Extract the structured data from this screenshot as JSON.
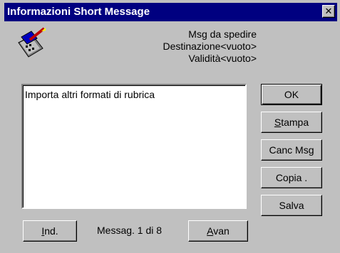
{
  "window": {
    "title": "Informazioni Short Message",
    "close": "✕"
  },
  "info": {
    "line1": "Msg da spedire",
    "line2": "Destinazione<vuoto>",
    "line3": "Validità<vuoto>"
  },
  "message": {
    "text": "Importa altri formati di rubrica"
  },
  "buttons": {
    "ok": "OK",
    "stampa_u": "S",
    "stampa_rest": "tampa",
    "canc_msg": "Canc Msg",
    "copia": "Copia .",
    "salva": "Salva"
  },
  "nav": {
    "ind_u": "I",
    "ind_rest": "nd.",
    "counter": "Messag. 1 di 8",
    "avan_u": "A",
    "avan_rest": "van"
  }
}
